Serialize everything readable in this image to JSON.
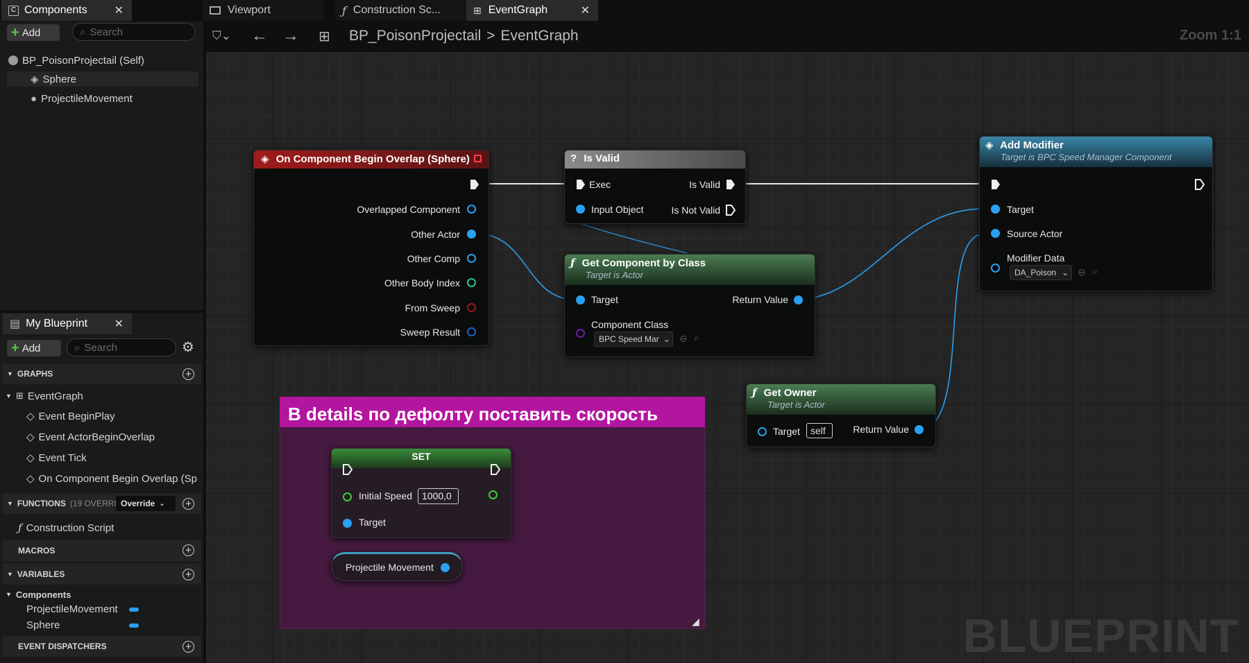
{
  "tabs": {
    "components": "Components",
    "viewport": "Viewport",
    "construction": "Construction Sc...",
    "eventgraph": "EventGraph"
  },
  "components_panel": {
    "add_label": "Add",
    "search_placeholder": "Search",
    "items": [
      "BP_PoisonProjectail (Self)",
      "Sphere",
      "ProjectileMovement"
    ]
  },
  "toolbar": {
    "breadcrumb_root": "BP_PoisonProjectail",
    "breadcrumb_sep": ">",
    "breadcrumb_current": "EventGraph",
    "zoom": "Zoom 1:1"
  },
  "my_blueprint": {
    "title": "My Blueprint",
    "add_label": "Add",
    "search_placeholder": "Search",
    "graphs_label": "GRAPHS",
    "event_graph": "EventGraph",
    "events": [
      "Event BeginPlay",
      "Event ActorBeginOverlap",
      "Event Tick",
      "On Component Begin Overlap (Sp"
    ],
    "functions_label": "FUNCTIONS",
    "functions_count": "(19 OVERRI",
    "override_label": "Override",
    "construction_script": "Construction Script",
    "macros_label": "MACROS",
    "variables_label": "VARIABLES",
    "components_category": "Components",
    "variables": [
      "ProjectileMovement",
      "Sphere"
    ],
    "event_dispatchers_label": "EVENT DISPATCHERS"
  },
  "graph": {
    "overlap_node": {
      "title": "On Component Begin Overlap (Sphere)",
      "pins": [
        "Overlapped Component",
        "Other Actor",
        "Other Comp",
        "Other Body Index",
        "From Sweep",
        "Sweep Result"
      ]
    },
    "isvalid_node": {
      "title": "Is Valid",
      "exec": "Exec",
      "is_valid": "Is Valid",
      "input_object": "Input Object",
      "is_not_valid": "Is Not Valid"
    },
    "getcomp_node": {
      "title": "Get Component by Class",
      "subtitle": "Target is Actor",
      "target": "Target",
      "return_value": "Return Value",
      "component_class": "Component Class",
      "class_value": "BPC Speed Mar"
    },
    "addmod_node": {
      "title": "Add Modifier",
      "subtitle": "Target is BPC Speed Manager Component",
      "target": "Target",
      "source_actor": "Source Actor",
      "modifier_data": "Modifier Data",
      "data_value": "DA_Poison"
    },
    "getowner_node": {
      "title": "Get Owner",
      "subtitle": "Target is Actor",
      "target": "Target",
      "self_value": "self",
      "return_value": "Return Value"
    },
    "comment": {
      "text": "В details по дефолту поставить скорость"
    },
    "set_node": {
      "title": "SET",
      "initial_speed": "Initial Speed",
      "speed_value": "1000,0",
      "target": "Target"
    },
    "projectile_node": {
      "label": "Projectile Movement"
    }
  },
  "watermark": "BLUEPRINT",
  "colors": {
    "event_header": "#8c1c1c",
    "pure_header": "#3f6d45",
    "call_header": "#2f6b86",
    "comment": "#6a1c5a",
    "comment_header": "#b3169e",
    "pin_object": "#2aa0f0",
    "pin_int": "#27c48a",
    "pin_bool": "#a01616",
    "pin_float": "#3bd13b",
    "pin_class": "#6a1ea8"
  }
}
